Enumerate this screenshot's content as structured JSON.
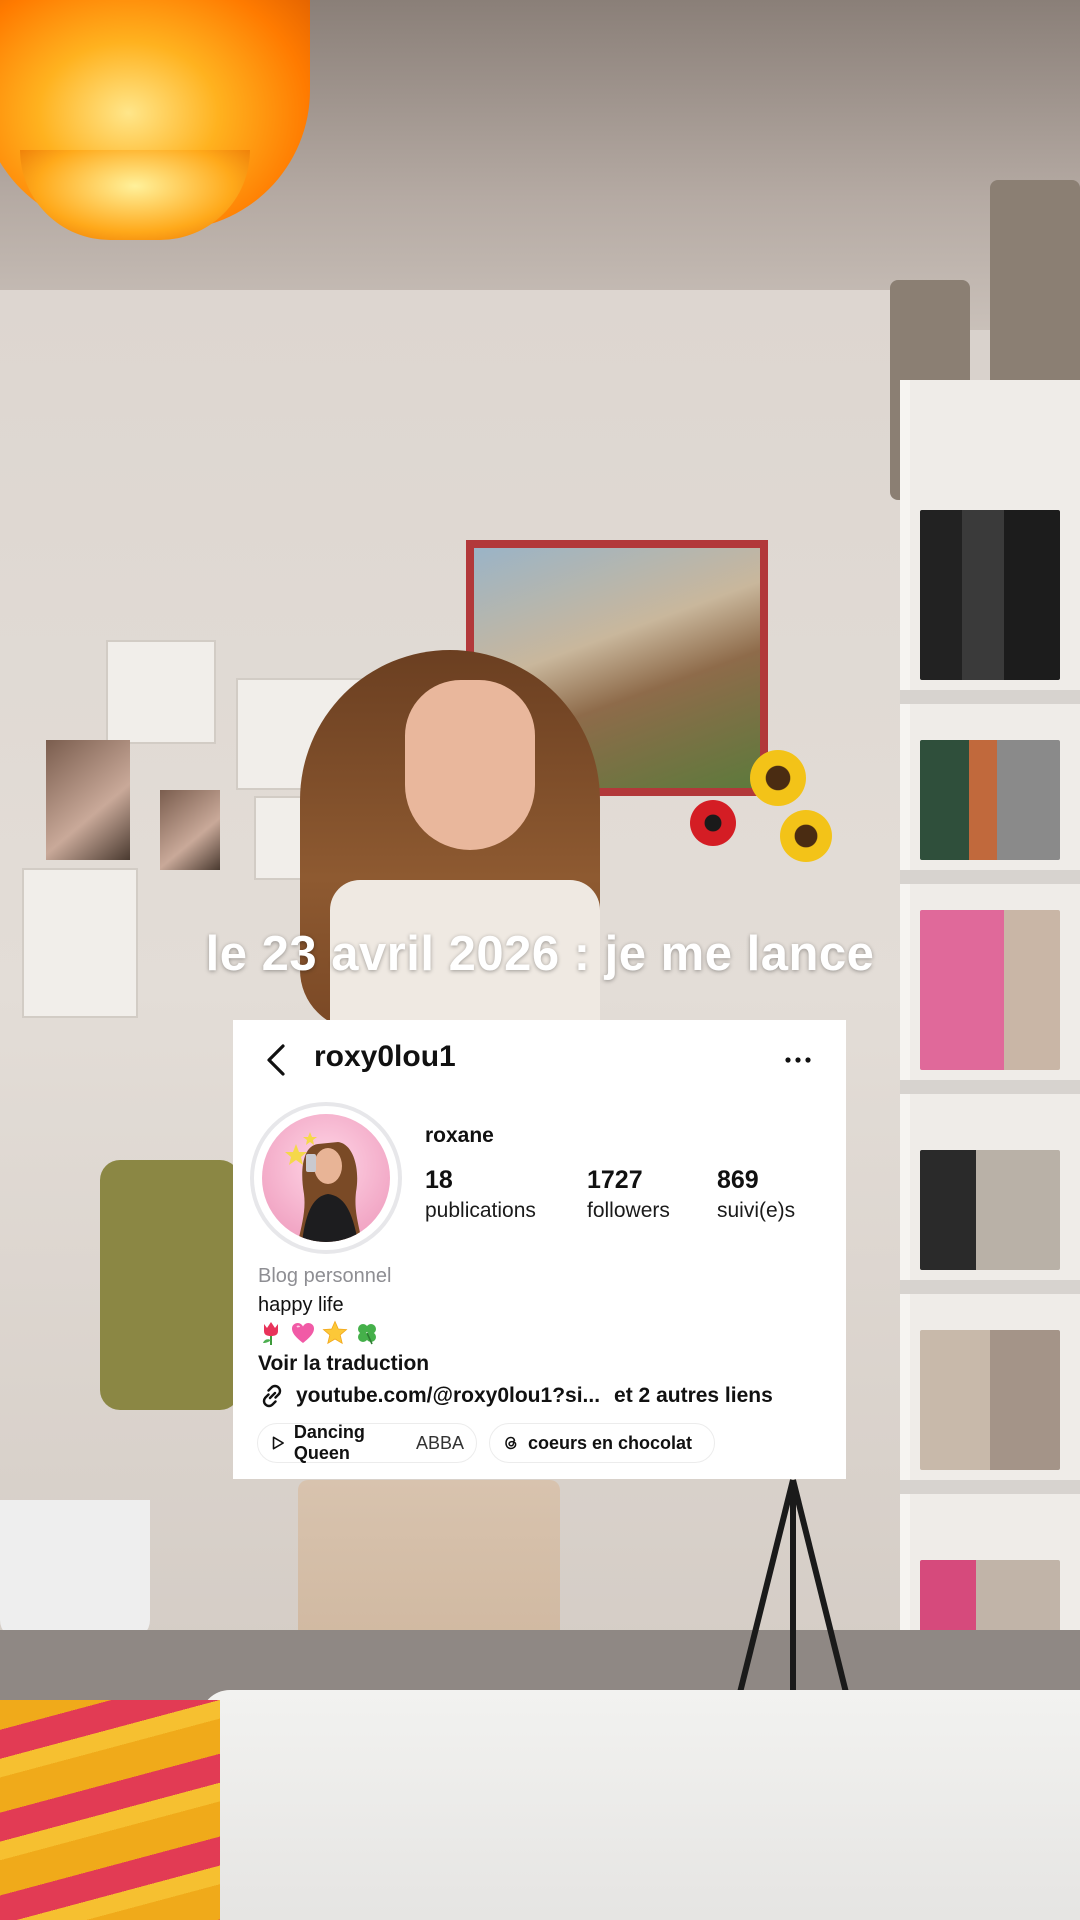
{
  "caption": "le 23 avril 2026 : je me lance",
  "profile": {
    "username": "roxy0lou1",
    "display_name": "roxane",
    "stats": [
      {
        "value": "18",
        "label": "publications"
      },
      {
        "value": "1727",
        "label": "followers"
      },
      {
        "value": "869",
        "label": "suivi(e)s"
      }
    ],
    "category": "Blog personnel",
    "bio": "happy life",
    "bio_emojis": [
      "tulip-emoji",
      "pink-heart-emoji",
      "star-emoji",
      "four-leaf-clover-emoji"
    ],
    "translate_label": "Voir la traduction",
    "link_text": "youtube.com/@roxy0lou1?si...",
    "link_more": "et 2 autres liens",
    "music_chip": {
      "title": "Dancing Queen",
      "artist": "ABBA",
      "icon": "play-icon"
    },
    "thread_chip": {
      "title": "coeurs en chocolat",
      "icon": "threads-icon"
    }
  },
  "colors": {
    "card_bg": "#ffffff",
    "text": "#111111",
    "category_gray": "#8e8e93",
    "caption": "#ffffff"
  }
}
